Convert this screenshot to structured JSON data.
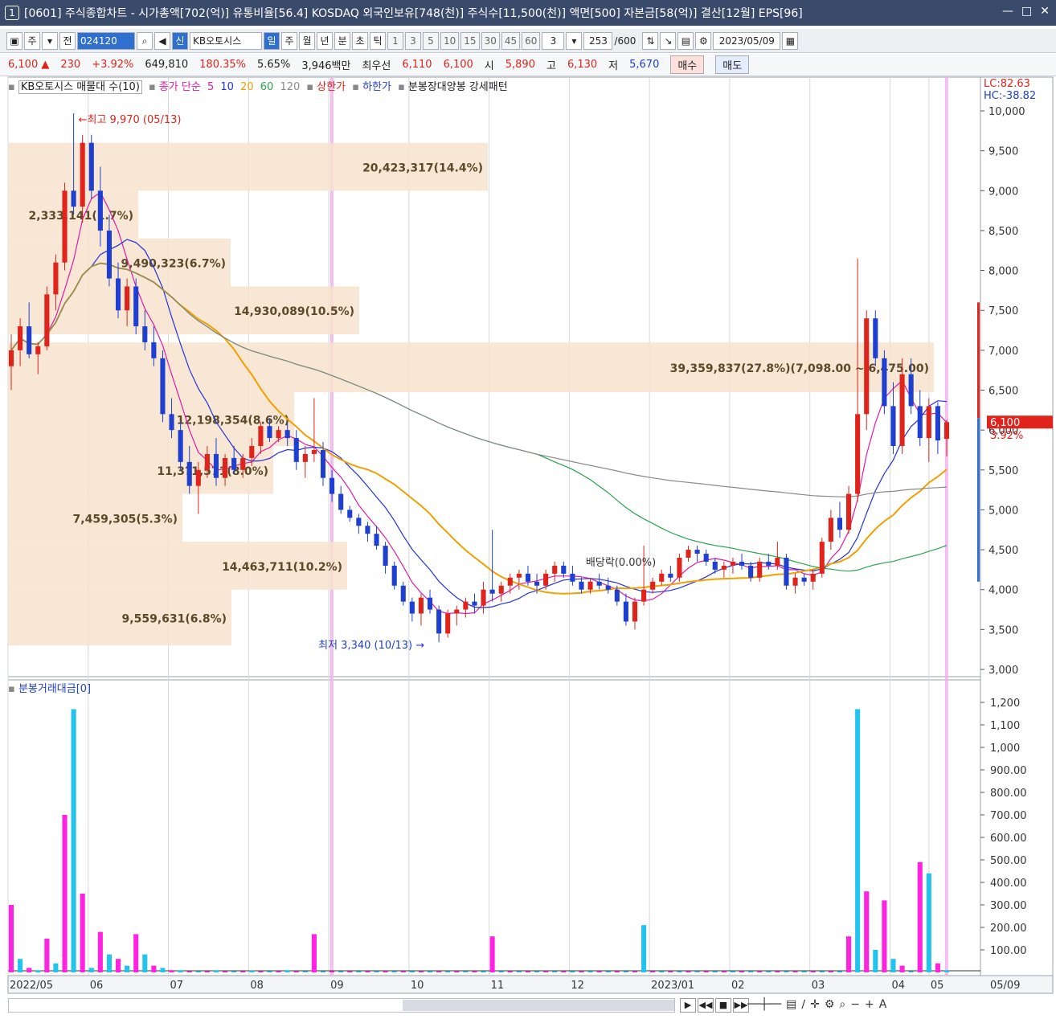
{
  "window": {
    "title": "[0601] 주식종합차트 - 시가총액[702(억)] 유통비율[56.4] KOSDAQ 외국인보유[748(천)] 주식수[11,500(천)] 액면[500] 자본금[58(억)] 결산[12월] EPS[96]",
    "window_number": "1",
    "controls": [
      "minimize",
      "restore",
      "close"
    ]
  },
  "toolbar": {
    "market": "주",
    "prev_label": "전",
    "code": "024120",
    "stock_name": "KB오토시스",
    "new_badge": "신",
    "period_tabs": [
      "일",
      "주",
      "월",
      "년",
      "분",
      "초",
      "틱"
    ],
    "active_period": "일",
    "interval_buttons": [
      "1",
      "3",
      "5",
      "10",
      "15",
      "30",
      "45",
      "60"
    ],
    "interval_value": "3",
    "count": "253",
    "count_total": "/600",
    "date": "2023/05/09"
  },
  "quote": {
    "price": "6,100",
    "direction": "▲",
    "change": "230",
    "change_pct": "+3.92%",
    "volume": "649,810",
    "volume_ratio": "180.35%",
    "turnover": "5.65%",
    "amount": "3,946백만",
    "best_ask_label": "최우선",
    "best_ask": "6,110",
    "best_bid": "6,100",
    "open_label": "시",
    "open": "5,890",
    "high_label": "고",
    "high": "6,130",
    "low_label": "저",
    "low": "5,670",
    "buy_label": "매수",
    "sell_label": "매도"
  },
  "legend": {
    "volume_profile": "KB오토시스 매물대 수(10)",
    "ma_title": "종가 단순",
    "ma_periods": [
      "5",
      "10",
      "20",
      "60",
      "120"
    ],
    "upper_limit": "상한가",
    "lower_limit": "하한가",
    "pattern": "분봉장대양봉 강세패턴",
    "lc": "LC:82.63",
    "hc": "HC:-38.82"
  },
  "sub_legend": "분봉거래대금[0]",
  "chart_data": {
    "type": "candlestick",
    "y_ticks": [
      "10,000",
      "9,500",
      "9,000",
      "8,500",
      "8,000",
      "7,500",
      "7,000",
      "6,500",
      "6,000",
      "5,500",
      "5,000",
      "4,500",
      "4,000",
      "3,500",
      "3,000"
    ],
    "ylim": [
      3000,
      10000
    ],
    "x_ticks": [
      "2022/05",
      "06",
      "07",
      "08",
      "09",
      "10",
      "11",
      "12",
      "2023/01",
      "02",
      "03",
      "04",
      "05"
    ],
    "x_right_label": "05/09",
    "last_price": "6,100",
    "last_pct": "3.92%",
    "max_note": "최고 9,970 (05/13)",
    "min_note": "최저 3,340 (10/13)",
    "dividend_note": "배당락(0.00%)",
    "volume_profile": [
      {
        "label": "20,423,317(14.4%)",
        "low": 9000,
        "high": 9600
      },
      {
        "label": "2,333,141(1.7%)",
        "low": 8400,
        "high": 9000
      },
      {
        "label": "9,490,323(6.7%)",
        "low": 7800,
        "high": 8400
      },
      {
        "label": "14,930,089(10.5%)",
        "low": 7200,
        "high": 7800
      },
      {
        "label": "39,359,837(27.8%)(7,098.00 ~ 6,475.00)",
        "low": 6475,
        "high": 7098
      },
      {
        "label": "12,198,354(8.6%)",
        "low": 5800,
        "high": 6475
      },
      {
        "label": "11,3?1,571(8.0%)",
        "low": 5200,
        "high": 5800
      },
      {
        "label": "7,459,305(5.3%)",
        "low": 4600,
        "high": 5200
      },
      {
        "label": "14,463,711(10.2%)",
        "low": 4000,
        "high": 4600
      },
      {
        "label": "9,559,631(6.8%)",
        "low": 3300,
        "high": 4000
      }
    ],
    "ohlc_key": [
      "x",
      "open",
      "high",
      "low",
      "close"
    ],
    "candles": [
      [
        0,
        6800,
        7200,
        6500,
        7000
      ],
      [
        1,
        7000,
        7400,
        6800,
        7300
      ],
      [
        2,
        7300,
        7600,
        6900,
        6950
      ],
      [
        3,
        6950,
        7100,
        6700,
        7050
      ],
      [
        4,
        7050,
        7800,
        7000,
        7700
      ],
      [
        5,
        7700,
        8200,
        7500,
        8100
      ],
      [
        6,
        8100,
        9100,
        8000,
        9000
      ],
      [
        7,
        9000,
        9970,
        8700,
        8800
      ],
      [
        8,
        8800,
        9700,
        8600,
        9600
      ],
      [
        9,
        9600,
        9700,
        8900,
        9000
      ],
      [
        10,
        9000,
        9300,
        8300,
        8500
      ],
      [
        11,
        8500,
        8700,
        7800,
        7900
      ],
      [
        12,
        7900,
        8100,
        7400,
        7500
      ],
      [
        13,
        7500,
        7900,
        7300,
        7800
      ],
      [
        14,
        7800,
        7900,
        7200,
        7300
      ],
      [
        15,
        7300,
        7500,
        7000,
        7100
      ],
      [
        16,
        7100,
        7300,
        6800,
        6900
      ],
      [
        17,
        6900,
        7000,
        6100,
        6200
      ],
      [
        18,
        6200,
        6400,
        5900,
        6000
      ],
      [
        19,
        6000,
        6100,
        5500,
        5600
      ],
      [
        20,
        5600,
        5800,
        5200,
        5300
      ],
      [
        21,
        5300,
        5600,
        4950,
        5500
      ],
      [
        22,
        5500,
        5800,
        5400,
        5700
      ],
      [
        23,
        5700,
        5900,
        5300,
        5400
      ],
      [
        24,
        5400,
        5700,
        5300,
        5650
      ],
      [
        25,
        5650,
        5800,
        5450,
        5500
      ],
      [
        26,
        5500,
        5700,
        5400,
        5650
      ],
      [
        27,
        5650,
        5900,
        5550,
        5800
      ],
      [
        28,
        5800,
        6100,
        5700,
        6050
      ],
      [
        29,
        6050,
        6150,
        5850,
        5900
      ],
      [
        30,
        5900,
        6050,
        5850,
        6000
      ],
      [
        31,
        6000,
        6100,
        5800,
        5900
      ],
      [
        32,
        5900,
        6000,
        5500,
        5600
      ],
      [
        33,
        5600,
        5800,
        5400,
        5700
      ],
      [
        34,
        5700,
        6400,
        5600,
        5750
      ],
      [
        35,
        5750,
        5850,
        5300,
        5400
      ],
      [
        36,
        5400,
        5500,
        5100,
        5200
      ],
      [
        37,
        5200,
        5300,
        4950,
        5000
      ],
      [
        38,
        5000,
        5050,
        4850,
        4900
      ],
      [
        39,
        4900,
        4950,
        4700,
        4800
      ],
      [
        40,
        4800,
        4850,
        4600,
        4700
      ],
      [
        41,
        4700,
        4800,
        4500,
        4550
      ],
      [
        42,
        4550,
        4600,
        4200,
        4300
      ],
      [
        43,
        4300,
        4350,
        4000,
        4050
      ],
      [
        44,
        4050,
        4100,
        3800,
        3850
      ],
      [
        45,
        3850,
        3900,
        3600,
        3700
      ],
      [
        46,
        3700,
        3950,
        3550,
        3900
      ],
      [
        47,
        3900,
        4000,
        3700,
        3750
      ],
      [
        48,
        3750,
        3800,
        3340,
        3450
      ],
      [
        49,
        3450,
        3750,
        3400,
        3700
      ],
      [
        50,
        3700,
        3800,
        3550,
        3750
      ],
      [
        51,
        3750,
        3900,
        3650,
        3850
      ],
      [
        52,
        3850,
        3950,
        3700,
        3800
      ],
      [
        53,
        3800,
        4100,
        3700,
        4000
      ],
      [
        54,
        4000,
        4750,
        3850,
        3950
      ],
      [
        55,
        3950,
        4100,
        3850,
        4050
      ],
      [
        56,
        4050,
        4200,
        3950,
        4150
      ],
      [
        57,
        4150,
        4250,
        4000,
        4200
      ],
      [
        58,
        4200,
        4300,
        4050,
        4100
      ],
      [
        59,
        4100,
        4200,
        3950,
        4050
      ],
      [
        60,
        4050,
        4250,
        4000,
        4200
      ],
      [
        61,
        4200,
        4350,
        4100,
        4300
      ],
      [
        62,
        4300,
        4350,
        4150,
        4200
      ],
      [
        63,
        4200,
        4300,
        4050,
        4100
      ],
      [
        64,
        4100,
        4150,
        3950,
        4000
      ],
      [
        65,
        4000,
        4150,
        3950,
        4100
      ],
      [
        66,
        4100,
        4200,
        4000,
        4050
      ],
      [
        67,
        4050,
        4150,
        3950,
        4000
      ],
      [
        68,
        4000,
        4050,
        3800,
        3850
      ],
      [
        69,
        3850,
        3950,
        3550,
        3600
      ],
      [
        70,
        3600,
        3900,
        3500,
        3850
      ],
      [
        71,
        3850,
        4550,
        3800,
        4000
      ],
      [
        72,
        4000,
        4150,
        3950,
        4100
      ],
      [
        73,
        4100,
        4250,
        4050,
        4200
      ],
      [
        74,
        4200,
        4300,
        4100,
        4150
      ],
      [
        75,
        4150,
        4450,
        4100,
        4400
      ],
      [
        76,
        4400,
        4550,
        4350,
        4500
      ],
      [
        77,
        4500,
        4550,
        4350,
        4450
      ],
      [
        78,
        4450,
        4500,
        4300,
        4350
      ],
      [
        79,
        4350,
        4400,
        4200,
        4250
      ],
      [
        80,
        4250,
        4350,
        4150,
        4300
      ],
      [
        81,
        4300,
        4400,
        4200,
        4350
      ],
      [
        82,
        4350,
        4450,
        4250,
        4300
      ],
      [
        83,
        4300,
        4350,
        4100,
        4150
      ],
      [
        84,
        4150,
        4400,
        4100,
        4350
      ],
      [
        85,
        4350,
        4450,
        4250,
        4300
      ],
      [
        86,
        4300,
        4600,
        4250,
        4400
      ],
      [
        87,
        4400,
        4450,
        4000,
        4050
      ],
      [
        88,
        4050,
        4200,
        3950,
        4150
      ],
      [
        89,
        4150,
        4200,
        4050,
        4100
      ],
      [
        90,
        4100,
        4250,
        4000,
        4200
      ],
      [
        91,
        4200,
        4650,
        4150,
        4600
      ],
      [
        92,
        4600,
        5000,
        4500,
        4900
      ],
      [
        93,
        4900,
        5100,
        4650,
        4750
      ],
      [
        94,
        4750,
        5300,
        4700,
        5200
      ],
      [
        95,
        5200,
        8150,
        5100,
        6200
      ],
      [
        96,
        6200,
        7500,
        6000,
        7400
      ],
      [
        97,
        7400,
        7500,
        6800,
        6900
      ],
      [
        98,
        6900,
        7000,
        6200,
        6300
      ],
      [
        99,
        6300,
        6600,
        5700,
        5800
      ],
      [
        100,
        5800,
        6900,
        5700,
        6700
      ],
      [
        101,
        6700,
        6900,
        6200,
        6300
      ],
      [
        102,
        6300,
        6500,
        5800,
        5900
      ],
      [
        103,
        5900,
        6400,
        5600,
        6300
      ],
      [
        104,
        6300,
        6350,
        5700,
        5870
      ],
      [
        105,
        5890,
        6130,
        5670,
        6100
      ]
    ],
    "ma_series": [
      {
        "name": "5",
        "color": "#e01ba8"
      },
      {
        "name": "10",
        "color": "#2232d8"
      },
      {
        "name": "20",
        "color": "#f0a000"
      },
      {
        "name": "60",
        "color": "#2aa54a"
      },
      {
        "name": "120",
        "color": "#888888"
      }
    ],
    "sub_chart": {
      "type": "bar",
      "y_ticks": [
        "1,200",
        "1,100",
        "1,000",
        "900.00",
        "800.00",
        "700.00",
        "600.00",
        "500.00",
        "400.00",
        "300.00",
        "200.00",
        "100.00"
      ],
      "ylim": [
        0,
        1250
      ],
      "values": [
        300,
        60,
        20,
        10,
        150,
        40,
        700,
        1170,
        350,
        20,
        180,
        80,
        60,
        30,
        170,
        80,
        30,
        20,
        10,
        10,
        5,
        5,
        5,
        10,
        5,
        5,
        5,
        8,
        5,
        5,
        5,
        10,
        5,
        5,
        170,
        5,
        5,
        5,
        5,
        5,
        5,
        5,
        5,
        5,
        5,
        5,
        5,
        5,
        5,
        5,
        5,
        5,
        5,
        5,
        160,
        5,
        5,
        5,
        5,
        5,
        5,
        5,
        5,
        5,
        5,
        5,
        5,
        5,
        5,
        5,
        5,
        210,
        5,
        5,
        5,
        5,
        5,
        5,
        5,
        5,
        5,
        5,
        5,
        5,
        5,
        5,
        5,
        5,
        5,
        5,
        5,
        5,
        5,
        5,
        160,
        1170,
        360,
        100,
        320,
        60,
        30,
        5,
        490,
        440,
        40,
        10
      ]
    },
    "highlight_x": [
      34,
      103
    ]
  }
}
